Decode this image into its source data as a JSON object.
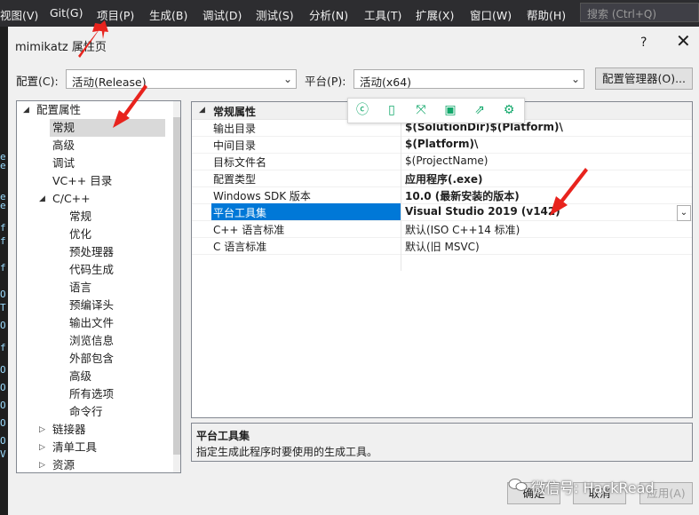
{
  "menu": {
    "items": [
      "视图(V)",
      "Git(G)",
      "项目(P)",
      "生成(B)",
      "调试(D)",
      "测试(S)",
      "分析(N)",
      "工具(T)",
      "扩展(X)",
      "窗口(W)",
      "帮助(H)"
    ],
    "search_placeholder": "搜索 (Ctrl+Q)"
  },
  "editor_strip": [
    "e",
    "e",
    "e",
    "e",
    "f",
    "f",
    "f",
    "O",
    "T",
    "O",
    "f",
    "O",
    "O",
    "O",
    "O",
    "O",
    "V"
  ],
  "dialog": {
    "title": "mimikatz 属性页",
    "help": "?",
    "close": "✕",
    "config_label": "配置(C):",
    "config_value": "活动(Release)",
    "platform_label": "平台(P):",
    "platform_value": "活动(x64)",
    "config_manager": "配置管理器(O)...",
    "ok": "确定",
    "cancel": "取消",
    "apply": "应用(A)"
  },
  "tree": [
    {
      "label": "配置属性",
      "level": 0,
      "expander": "◢"
    },
    {
      "label": "常规",
      "level": 1,
      "selected": true
    },
    {
      "label": "高级",
      "level": 1
    },
    {
      "label": "调试",
      "level": 1
    },
    {
      "label": "VC++ 目录",
      "level": 1
    },
    {
      "label": "C/C++",
      "level": 1,
      "expander": "◢"
    },
    {
      "label": "常规",
      "level": 2
    },
    {
      "label": "优化",
      "level": 2
    },
    {
      "label": "预处理器",
      "level": 2
    },
    {
      "label": "代码生成",
      "level": 2
    },
    {
      "label": "语言",
      "level": 2
    },
    {
      "label": "预编译头",
      "level": 2
    },
    {
      "label": "输出文件",
      "level": 2
    },
    {
      "label": "浏览信息",
      "level": 2
    },
    {
      "label": "外部包含",
      "level": 2
    },
    {
      "label": "高级",
      "level": 2
    },
    {
      "label": "所有选项",
      "level": 2
    },
    {
      "label": "命令行",
      "level": 2
    },
    {
      "label": "链接器",
      "level": 1,
      "expander": "▷"
    },
    {
      "label": "清单工具",
      "level": 1,
      "expander": "▷"
    },
    {
      "label": "资源",
      "level": 1,
      "expander": "▷"
    }
  ],
  "grid": {
    "category": "常规属性",
    "category_expander": "◢",
    "rows": [
      {
        "name": "输出目录",
        "value": "$(SolutionDir)$(Platform)\\",
        "bold": true
      },
      {
        "name": "中间目录",
        "value": "$(Platform)\\",
        "bold": true
      },
      {
        "name": "目标文件名",
        "value": "$(ProjectName)",
        "bold": false
      },
      {
        "name": "配置类型",
        "value": "应用程序(.exe)",
        "bold": true
      },
      {
        "name": "Windows SDK 版本",
        "value": "10.0 (最新安装的版本)",
        "bold": true
      },
      {
        "name": "平台工具集",
        "value": "Visual Studio 2019 (v142)",
        "bold": true,
        "selected": true
      },
      {
        "name": "C++ 语言标准",
        "value": "默认(ISO C++14 标准)",
        "bold": false
      },
      {
        "name": "C 语言标准",
        "value": "默认(旧 MSVC)",
        "bold": false
      }
    ]
  },
  "float_toolbar": [
    "ⓒ",
    "▯",
    "⤧",
    "▣",
    "⇗",
    "⚙"
  ],
  "description": {
    "title": "平台工具集",
    "text": "指定生成此程序时要使用的生成工具。"
  },
  "watermark": "微信号: HackRead",
  "colors": {
    "menubar": "#2d2d30",
    "selection": "#0078d7",
    "arrow": "#e8231d",
    "toolbar_icon": "#12a86b"
  }
}
